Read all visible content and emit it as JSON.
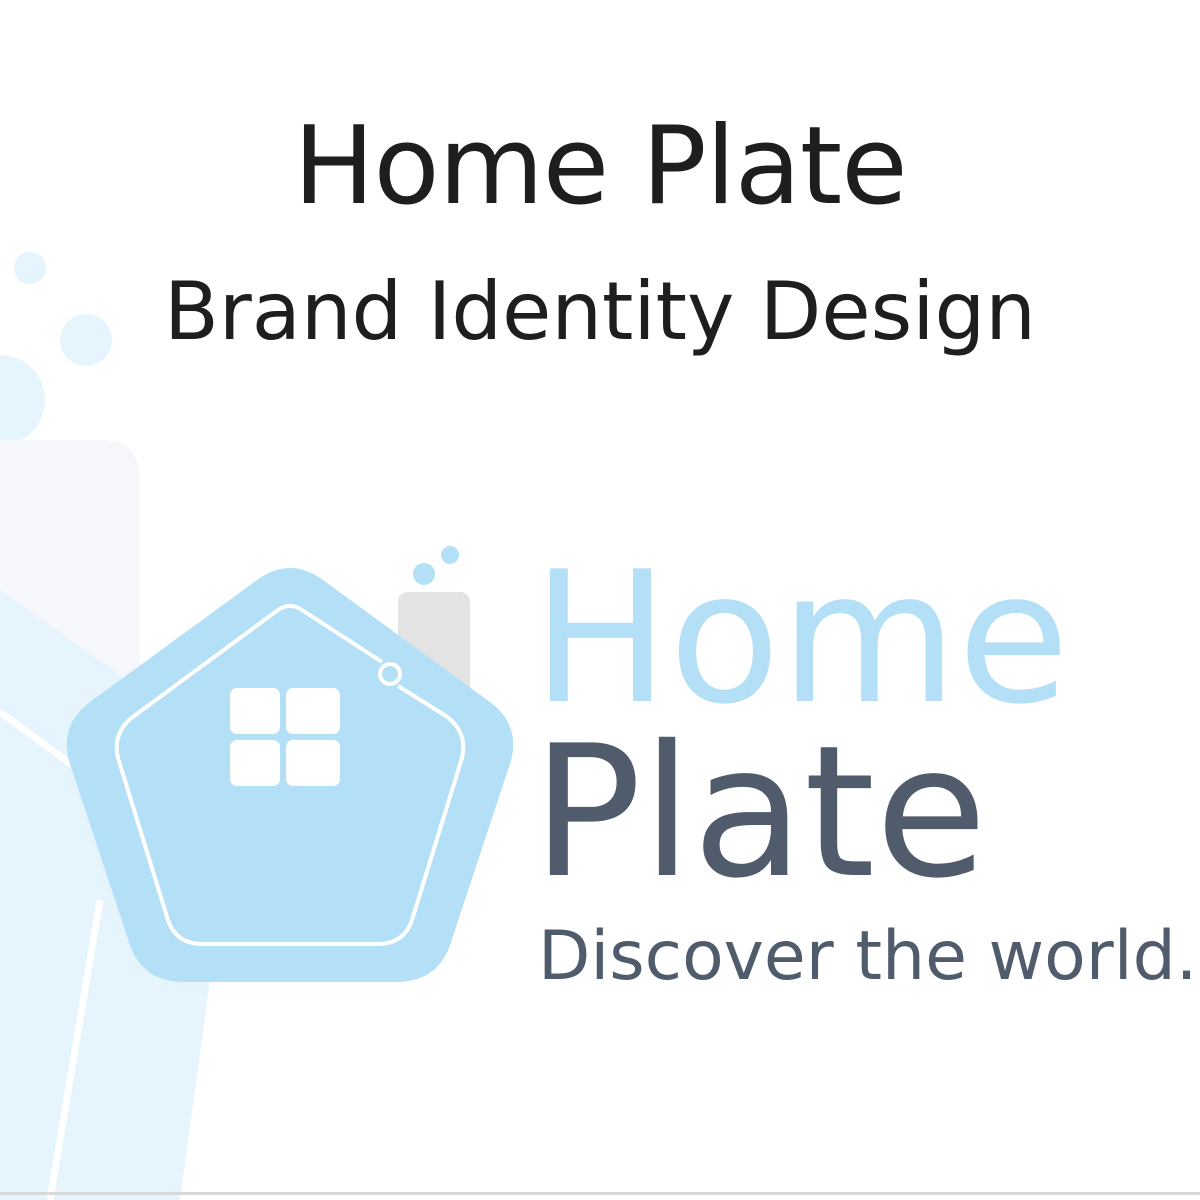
{
  "header": {
    "title": "Home Plate",
    "subtitle": "Brand Identity Design"
  },
  "logo": {
    "word_home": "Home",
    "word_plate": "Plate",
    "tagline": "Discover the world.",
    "icon": "house-pentagon-icon"
  },
  "colors": {
    "heading_text": "#1f1d1d",
    "brand_light_blue": "#b3e0f7",
    "brand_slate": "#505b6b",
    "decor_light_blue": "#e6f4fd",
    "decor_grey": "#f5f7fa",
    "chimney_grey": "#e3e3e3",
    "background": "#ffffff"
  }
}
